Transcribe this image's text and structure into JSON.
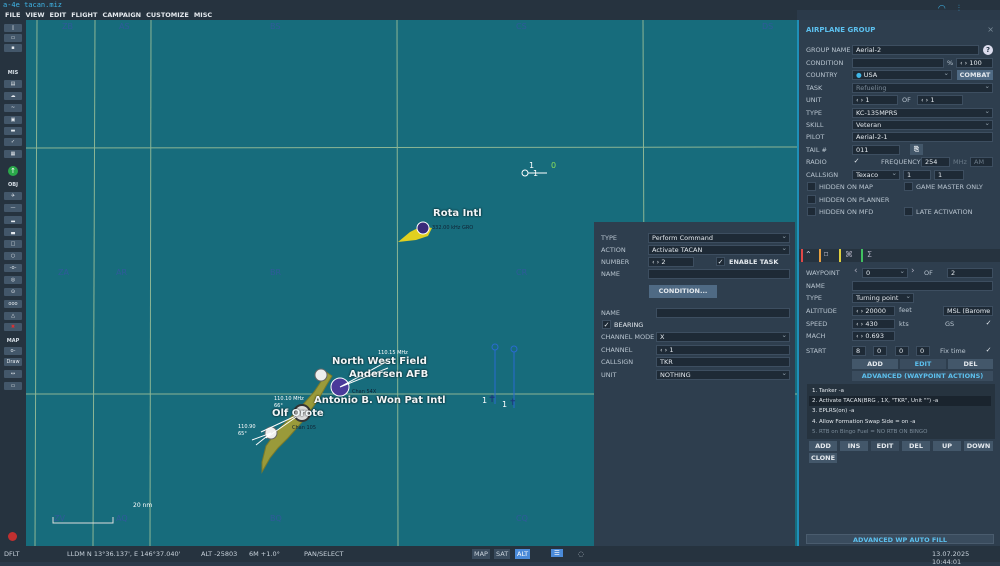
{
  "title": "a-4e tacan.miz",
  "menu": [
    "FILE",
    "VIEW",
    "EDIT",
    "FLIGHT",
    "CAMPAIGN",
    "CUSTOMIZE",
    "MISC"
  ],
  "toolbar": {
    "mis_label": "MIS",
    "obj_label": "OBJ",
    "map_label": "MAP",
    "draw_label": "Draw"
  },
  "map": {
    "grid_top": [
      "ZB",
      "AS",
      "BS",
      "CS",
      "DS"
    ],
    "grid_mid": [
      "ZA",
      "AR",
      "BR",
      "CR"
    ],
    "grid_bot": [
      "ZV",
      "AQ",
      "BQ",
      "CQ"
    ],
    "airports": [
      "Rota Intl",
      "North West Field",
      "Andersen AFB",
      "Antonio B. Won Pat Intl",
      "Olf Orote"
    ],
    "rota_beacon": "332.00 kHz GRO",
    "freqs": [
      "110.15 MHz",
      "110.10 MHz",
      "110.90",
      "65°",
      "66°",
      "Chan 54X",
      "Chan 105"
    ],
    "group_labels": [
      "1",
      "1",
      "0",
      "1",
      "1",
      "1",
      "1"
    ],
    "scale": "20 nm"
  },
  "group": {
    "header": "AIRPLANE GROUP",
    "close": "×",
    "labels": {
      "name": "GROUP NAME",
      "condition": "CONDITION",
      "country": "COUNTRY",
      "task": "TASK",
      "unit": "UNIT",
      "of": "OF",
      "type": "TYPE",
      "skill": "SKILL",
      "pilot": "PILOT",
      "tail": "TAIL #",
      "radio": "RADIO",
      "frequency": "FREQUENCY",
      "mhz": "MHz",
      "callsign": "CALLSIGN",
      "pct": "%"
    },
    "name": "Aerial-2",
    "help": "?",
    "condition": "",
    "condition_pct": "100",
    "country": "USA",
    "combat": "COMBAT",
    "task": "Refueling",
    "unit": "1",
    "unit_of": "1",
    "type": "KC-135MPRS",
    "skill": "Veteran",
    "pilot": "Aerial-2-1",
    "tail": "011",
    "frequency": "254",
    "modulation": "AM",
    "callsign": "Texaco",
    "callsign_n1": "1",
    "callsign_n2": "1",
    "checks": {
      "hidden_map": "HIDDEN ON MAP",
      "game_master": "GAME MASTER ONLY",
      "hidden_planner": "HIDDEN ON PLANNER",
      "hidden_mfd": "HIDDEN ON MFD",
      "late": "LATE ACTIVATION"
    }
  },
  "waypoint": {
    "labels": {
      "waypoint": "WAYPOINT",
      "of": "OF",
      "name": "NAME",
      "type": "TYPE",
      "altitude": "ALTITUDE",
      "feet": "feet",
      "speed": "SPEED",
      "kts": "kts",
      "gs": "GS",
      "mach": "MACH",
      "start": "START",
      "fix": "Fix time"
    },
    "index": "0",
    "count": "2",
    "name": "",
    "type": "Turning point",
    "altitude": "20000",
    "alt_ref": "MSL (Barome",
    "speed": "430",
    "mach": "0.693",
    "start": [
      "8",
      "0",
      "0",
      "0"
    ],
    "add": "ADD",
    "edit": "EDIT",
    "del": "DEL",
    "advanced": "ADVANCED (WAYPOINT ACTIONS)",
    "actions": [
      "1. Tanker -a",
      "2. Activate TACAN(BRG , 1X, \"TKR\", Unit \"\")  -a",
      "3. EPLRS(on)  -a",
      "4. Allow Formation Swap Side = on -a",
      "5. RTB on Bingo Fuel = NO RTB ON BINGO"
    ],
    "buttons": [
      "ADD",
      "INS",
      "EDIT",
      "DEL",
      "UP",
      "DOWN",
      "CLONE"
    ],
    "autofill": "ADVANCED WP AUTO FILL"
  },
  "task": {
    "labels": {
      "type": "TYPE",
      "action": "ACTION",
      "number": "NUMBER",
      "name": "NAME",
      "enable": "ENABLE TASK",
      "name2": "NAME",
      "bearing": "BEARING",
      "mode": "CHANNEL MODE",
      "channel": "CHANNEL",
      "callsign": "CALLSIGN",
      "unit": "UNIT"
    },
    "type": "Perform Command",
    "action": "Activate TACAN",
    "number": "2",
    "condition": "CONDITION...",
    "mode": "X",
    "channel": "1",
    "callsign": "TKR",
    "unit": "NOTHING"
  },
  "status": {
    "profile": "DFLT",
    "coords": "LLDM  N 13°36.137', E 146°37.040'",
    "alt": "ALT  -25803",
    "m": "6M  +1.0°",
    "mode": "PAN/SELECT",
    "map": "MAP",
    "sat": "SAT",
    "alt_btn": "ALT",
    "datetime": "13.07.2025 10:44:01"
  }
}
